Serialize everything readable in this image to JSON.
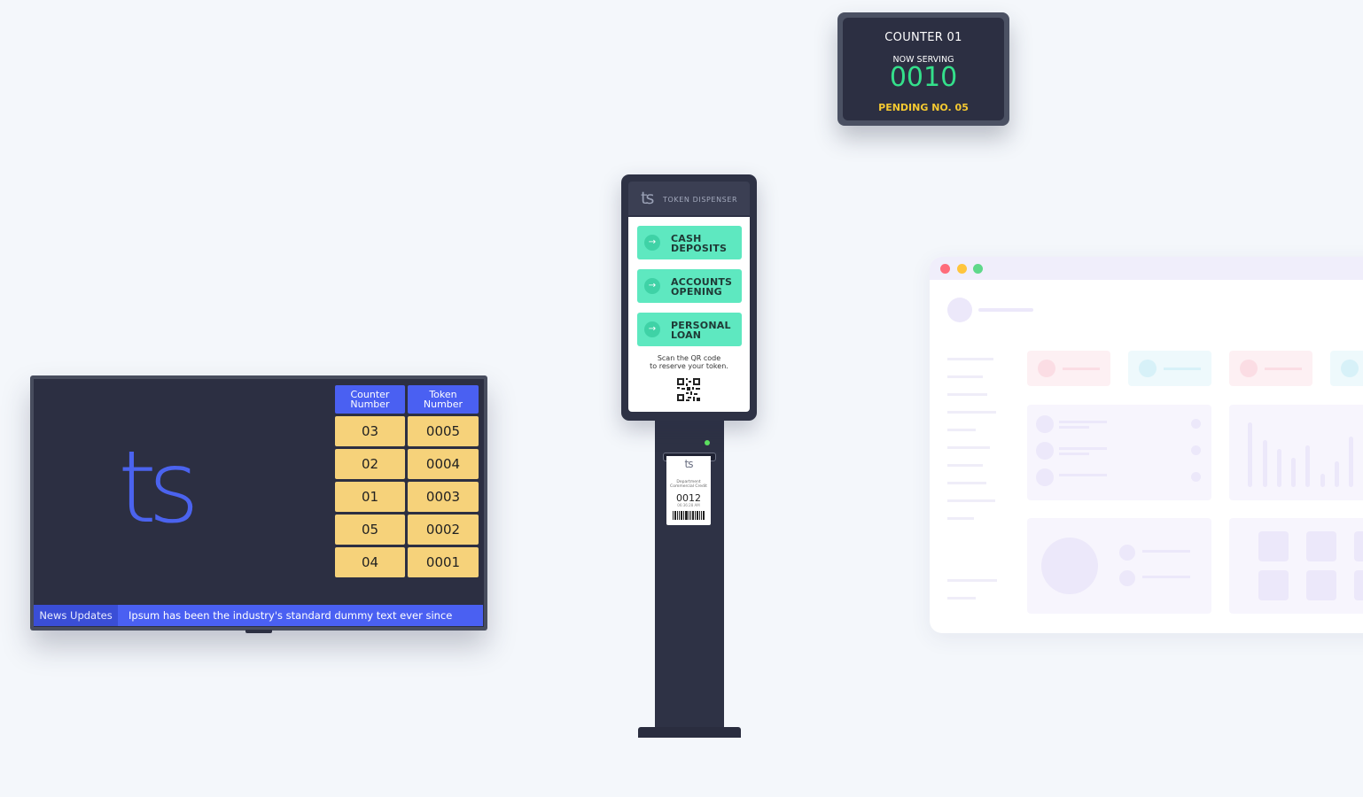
{
  "counter_display": {
    "title": "COUNTER 01",
    "now_serving_label": "NOW SERVING",
    "now_serving_number": "0010",
    "pending_text": "PENDING NO. 05",
    "colors": {
      "number": "#34e08b",
      "pending": "#f5c931"
    }
  },
  "tv": {
    "logo": "ts",
    "headers": {
      "counter": "Counter\nNumber",
      "token": "Token\nNumber"
    },
    "rows": [
      {
        "counter": "03",
        "token": "0005"
      },
      {
        "counter": "02",
        "token": "0004"
      },
      {
        "counter": "01",
        "token": "0003"
      },
      {
        "counter": "05",
        "token": "0002"
      },
      {
        "counter": "04",
        "token": "0001"
      }
    ],
    "news_label": "News Updates",
    "news_text": "Ipsum has been the industry's standard dummy text ever since"
  },
  "kiosk": {
    "logo": "ts",
    "brand": "TOKEN DISPENSER",
    "services": [
      {
        "line1": "CASH",
        "line2": "DEPOSITS",
        "icon": "arrow-right-icon"
      },
      {
        "line1": "ACCOUNTS",
        "line2": "OPENING",
        "icon": "arrow-right-icon"
      },
      {
        "line1": "PERSONAL",
        "line2": "LOAN",
        "icon": "arrow-right-icon"
      }
    ],
    "scan_line1": "Scan the QR code",
    "scan_line2": "to reserve your token."
  },
  "ticket": {
    "logo": "ts",
    "dept_line1": "Department",
    "dept_line2": "Commercial Credit",
    "number": "0012",
    "time": "06:36:28 AM"
  },
  "browser": {
    "dots": [
      "#ff6b7a",
      "#ffc53d",
      "#5fd88a"
    ]
  }
}
